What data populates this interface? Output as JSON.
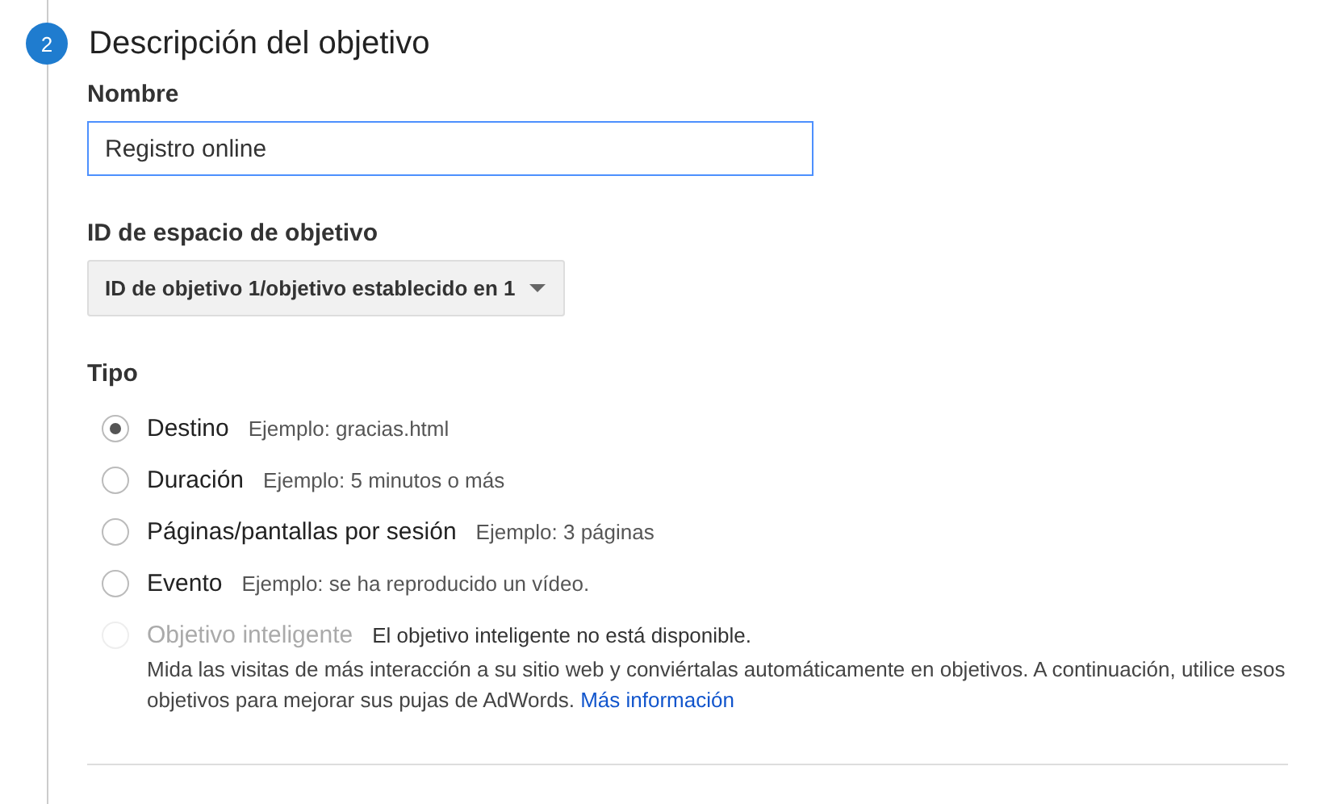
{
  "step": {
    "number": "2",
    "title": "Descripción del objetivo"
  },
  "name_field": {
    "label": "Nombre",
    "value": "Registro online"
  },
  "slot_id": {
    "label": "ID de espacio de objetivo",
    "value": "ID de objetivo 1/objetivo establecido en 1"
  },
  "type": {
    "label": "Tipo",
    "options": [
      {
        "label": "Destino",
        "example": "Ejemplo: gracias.html",
        "selected": true,
        "disabled": false
      },
      {
        "label": "Duración",
        "example": "Ejemplo: 5 minutos o más",
        "selected": false,
        "disabled": false
      },
      {
        "label": "Páginas/pantallas por sesión",
        "example": "Ejemplo: 3 páginas",
        "selected": false,
        "disabled": false
      },
      {
        "label": "Evento",
        "example": "Ejemplo: se ha reproducido un vídeo.",
        "selected": false,
        "disabled": false
      },
      {
        "label": "Objetivo inteligente",
        "example": "El objetivo inteligente no está disponible.",
        "selected": false,
        "disabled": true
      }
    ]
  },
  "smart_goal_description": {
    "text": "Mida las visitas de más interacción a su sitio web y conviértalas automáticamente en objetivos. A continuación, utilice esos objetivos para mejorar sus pujas de AdWords.",
    "link": "Más información"
  }
}
